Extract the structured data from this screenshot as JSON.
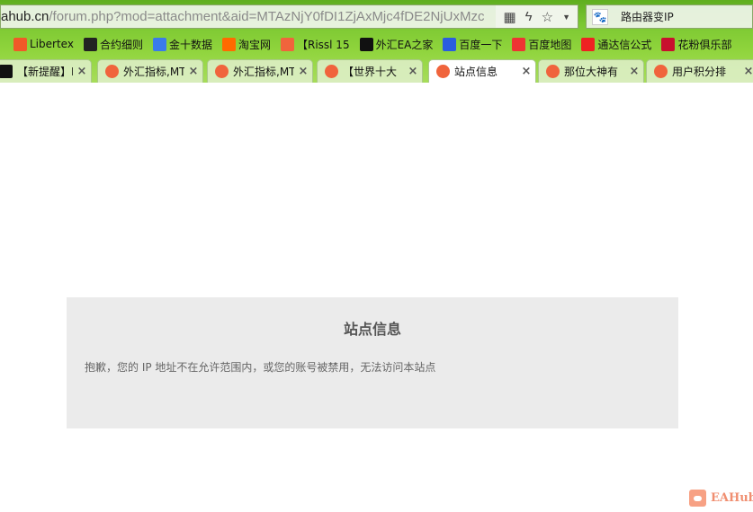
{
  "browser": {
    "url_host": "ahub.cn",
    "url_path": "/forum.php?mod=attachment&aid=MTAzNjY0fDI1ZjAxMjc4fDE2NjUxMzc",
    "search_value": "路由器变IP",
    "bookmarks": [
      {
        "label": "Libertex",
        "icon": "libertex-icon",
        "color": "#f05a28"
      },
      {
        "label": "合约细则",
        "icon": "contract-icon",
        "color": "#222"
      },
      {
        "label": "金十数据",
        "icon": "jin10-icon",
        "color": "#3a7bea"
      },
      {
        "label": "淘宝网",
        "icon": "taobao-icon",
        "color": "#ff6a00"
      },
      {
        "label": "【Rissl 15",
        "icon": "eahub-icon",
        "color": "#f0643c"
      },
      {
        "label": "外汇EA之家",
        "icon": "e-icon",
        "color": "#111"
      },
      {
        "label": "百度一下",
        "icon": "baidu-icon",
        "color": "#2a5de0"
      },
      {
        "label": "百度地图",
        "icon": "baidu-map-icon",
        "color": "#e33"
      },
      {
        "label": "通达信公式",
        "icon": "gupiao-icon",
        "color": "#e22"
      },
      {
        "label": "花粉俱乐部",
        "icon": "huawei-icon",
        "color": "#c8102e"
      }
    ],
    "tabs": [
      {
        "label": "【新提醒】E",
        "active": false
      },
      {
        "label": "外汇指标,MT",
        "active": false
      },
      {
        "label": "外汇指标,MT",
        "active": false
      },
      {
        "label": "【世界十大",
        "active": false
      },
      {
        "label": "站点信息",
        "active": true
      },
      {
        "label": "那位大神有",
        "active": false
      },
      {
        "label": "用户积分排",
        "active": false
      }
    ]
  },
  "page": {
    "title": "站点信息",
    "message": "抱歉，您的 IP 地址不在允许范围内，或您的账号被禁用，无法访问本站点",
    "logo_text": "EAHub"
  }
}
